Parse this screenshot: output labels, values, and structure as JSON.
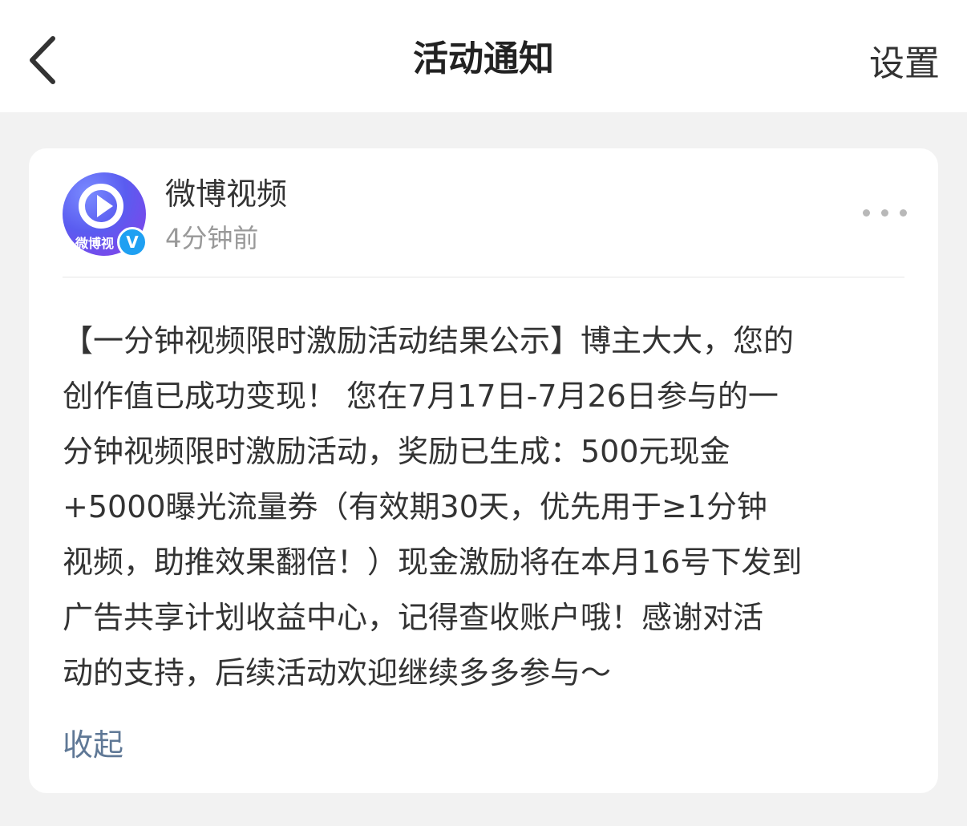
{
  "nav": {
    "title": "活动通知",
    "settings_label": "设置",
    "back_icon": "chevron-left-icon"
  },
  "notification": {
    "sender_name": "微博视频",
    "time_ago": "4分钟前",
    "avatar_text": "微博视",
    "verified_mark": "V",
    "more_icon": "more-dots-icon",
    "body_lines": [
      "【一分钟视频限时激励活动结果公示】博主大大，您的",
      "创作值已成功变现！ 您在7月17日-7月26日参与的一",
      "分钟视频限时激励活动，奖励已生成：500元现金",
      "+5000曝光流量券（有效期30天，优先用于≥1分钟",
      "视频，助推效果翻倍！）现金激励将在本月16号下发到",
      "广告共享计划收益中心，记得查收账户哦！感谢对活",
      "动的支持，后续活动欢迎继续多多参与～"
    ],
    "collapse_label": "收起"
  },
  "colors": {
    "background": "#f2f2f2",
    "card": "#ffffff",
    "link": "#5f7896",
    "verified": "#1fa0f2",
    "avatar_gradient": [
      "#7a8bff",
      "#5a5cf0",
      "#8a3ee8"
    ]
  }
}
